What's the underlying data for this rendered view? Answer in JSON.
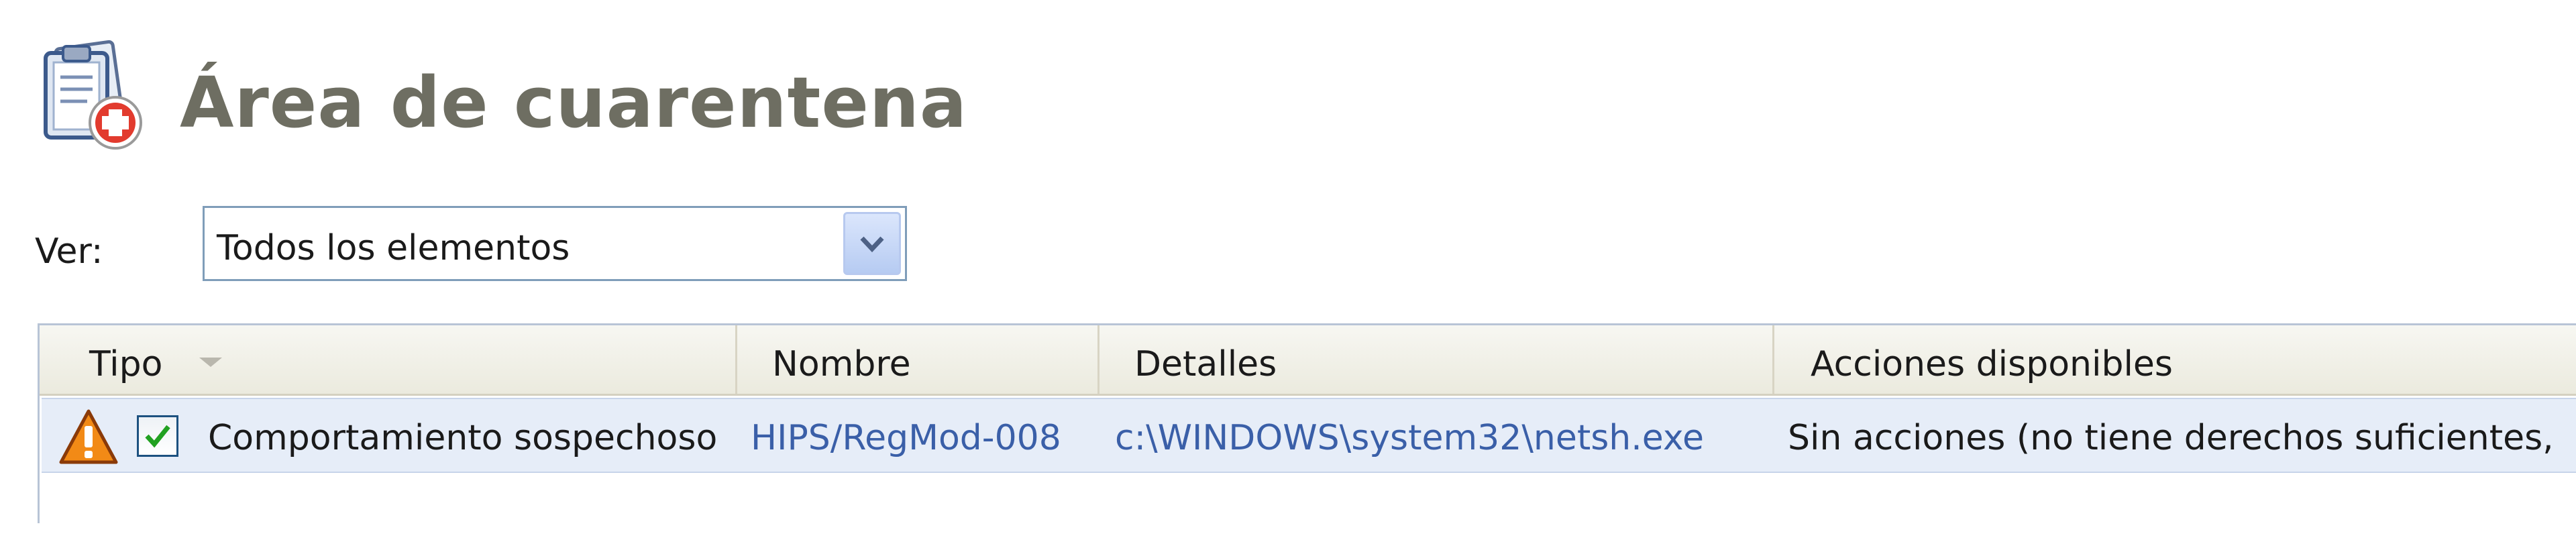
{
  "header": {
    "title": "Área de cuarentena",
    "icon": "quarantine-clipboard-icon"
  },
  "view_filter": {
    "label": "Ver:",
    "selected": "Todos los elementos",
    "dropdown_icon": "chevron-down-icon"
  },
  "table": {
    "columns": [
      {
        "label": "Tipo",
        "sorted": true
      },
      {
        "label": "Nombre"
      },
      {
        "label": "Detalles"
      },
      {
        "label": "Acciones disponibles"
      }
    ],
    "rows": [
      {
        "type_icon": "warning-icon",
        "checked": true,
        "type": "Comportamiento sospechoso",
        "name": "HIPS/RegMod-008",
        "details": "c:\\WINDOWS\\system32\\netsh.exe",
        "actions": "Sin acciones (no tiene derechos suficientes,"
      }
    ]
  },
  "colors": {
    "title": "#6e6e62",
    "link": "#3a5fa8",
    "row_highlight": "#e6edf8",
    "header_bg": "#ebeade"
  }
}
